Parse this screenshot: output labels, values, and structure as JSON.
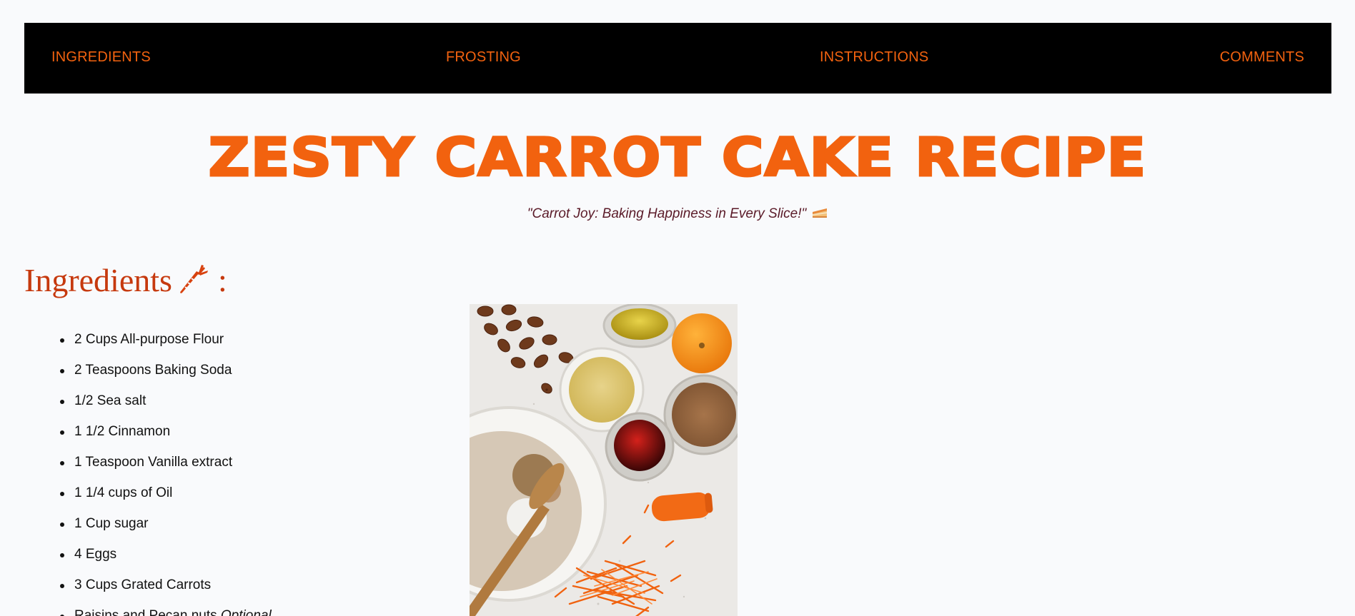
{
  "nav": {
    "items": [
      {
        "label": "INGREDIENTS"
      },
      {
        "label": "FROSTING"
      },
      {
        "label": "INSTRUCTIONS"
      },
      {
        "label": "COMMENTS"
      }
    ]
  },
  "header": {
    "title": "ZESTY CARROT CAKE RECIPE",
    "subtitle": "\"Carrot Joy: Baking Happiness in Every Slice!\"",
    "subtitle_icon": "cake-slice-icon"
  },
  "ingredients": {
    "heading": "Ingredients",
    "heading_icon": "carrot-icon",
    "heading_suffix": ":",
    "items": [
      {
        "text": "2 Cups All-purpose Flour"
      },
      {
        "text": "2 Teaspoons Baking Soda"
      },
      {
        "text": "1/2 Sea salt"
      },
      {
        "text": "1 1/2 Cinnamon"
      },
      {
        "text": "1 Teaspoon Vanilla extract"
      },
      {
        "text": "1 1/4 cups of Oil"
      },
      {
        "text": "1 Cup sugar"
      },
      {
        "text": "4 Eggs"
      },
      {
        "text": "3 Cups Grated Carrots"
      },
      {
        "text": "Raisins and Pecan nuts ",
        "note": "Optional"
      }
    ],
    "photo_icon": "ingredients-photo"
  },
  "colors": {
    "accent": "#f2620f",
    "heading": "#c6390e",
    "nav_background": "#000000",
    "page_background": "#f9fafc",
    "subtitle": "#5a1a28"
  }
}
